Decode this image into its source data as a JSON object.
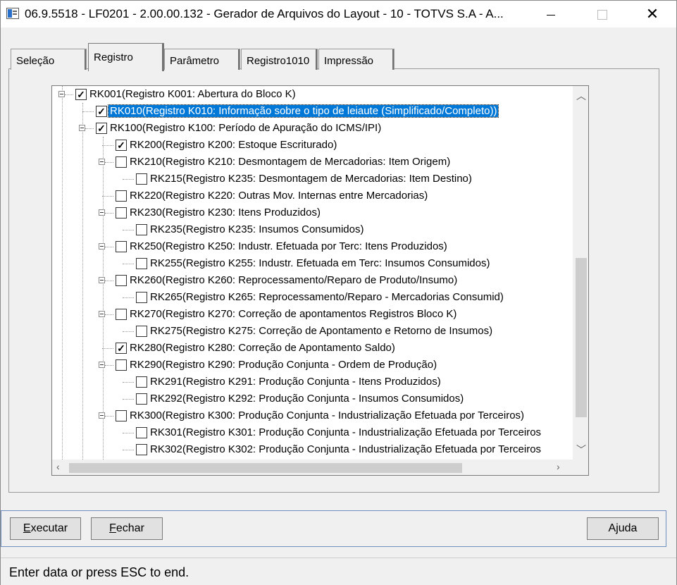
{
  "window": {
    "title": "06.9.5518 - LF0201 - 2.00.00.132 - Gerador de Arquivos do Layout - 10 - TOTVS S.A - A..."
  },
  "tabs": [
    {
      "label": "Seleção"
    },
    {
      "label": "Registro"
    },
    {
      "label": "Parâmetro"
    },
    {
      "label": "Registro1010"
    },
    {
      "label": "Impressão"
    }
  ],
  "tree": {
    "nodes": [
      {
        "label": "RK001(Registro K001: Abertura do Bloco K)",
        "checked": true
      },
      {
        "label": "RK010(Registro K010: Informação sobre o tipo de leiaute (Simplificado/Completo))",
        "checked": true,
        "selected": true
      },
      {
        "label": "RK100(Registro K100: Período de Apuração do ICMS/IPI)",
        "checked": true
      },
      {
        "label": "RK200(Registro K200: Estoque Escriturado)",
        "checked": true
      },
      {
        "label": "RK210(Registro K210: Desmontagem de Mercadorias: Item Origem)",
        "checked": false
      },
      {
        "label": "RK215(Registro K235: Desmontagem de Mercadorias: Item Destino)",
        "checked": false
      },
      {
        "label": "RK220(Registro K220: Outras Mov. Internas entre Mercadorias)",
        "checked": false
      },
      {
        "label": "RK230(Registro K230: Itens Produzidos)",
        "checked": false
      },
      {
        "label": "RK235(Registro K235: Insumos Consumidos)",
        "checked": false
      },
      {
        "label": "RK250(Registro K250: Industr. Efetuada por Terc: Itens Produzidos)",
        "checked": false
      },
      {
        "label": "RK255(Registro K255: Industr. Efetuada em Terc: Insumos Consumidos)",
        "checked": false
      },
      {
        "label": "RK260(Registro K260: Reprocessamento/Reparo de Produto/Insumo)",
        "checked": false
      },
      {
        "label": "RK265(Registro K265: Reprocessamento/Reparo - Mercadorias Consumid)",
        "checked": false
      },
      {
        "label": "RK270(Registro K270: Correção de apontamentos Registros Bloco K)",
        "checked": false
      },
      {
        "label": "RK275(Registro K275: Correção de Apontamento e Retorno de Insumos)",
        "checked": false
      },
      {
        "label": "RK280(Registro K280: Correção de Apontamento Saldo)",
        "checked": true
      },
      {
        "label": "RK290(Registro K290: Produção Conjunta - Ordem de Produção)",
        "checked": false
      },
      {
        "label": "RK291(Registro K291: Produção Conjunta - Itens Produzidos)",
        "checked": false
      },
      {
        "label": "RK292(Registro K292: Produção Conjunta - Insumos Consumidos)",
        "checked": false
      },
      {
        "label": "RK300(Registro K300: Produção Conjunta - Industrialização Efetuada por Terceiros)",
        "checked": false
      },
      {
        "label": "RK301(Registro K301: Produção Conjunta - Industrialização Efetuada por Terceiros",
        "checked": false
      },
      {
        "label": "RK302(Registro K302: Produção Conjunta - Industrialização Efetuada por Terceiros",
        "checked": false
      }
    ]
  },
  "buttons": {
    "executar": {
      "first": "E",
      "rest": "xecutar"
    },
    "fechar": {
      "first": "F",
      "rest": "echar"
    },
    "ajuda": "Ajuda"
  },
  "status": "Enter data or press ESC to end.",
  "colors": {
    "selection": "#0078d7",
    "bottom_border": "#6d8fc0"
  },
  "icons": [
    "app-icon",
    "minimize-icon",
    "maximize-icon",
    "close-icon",
    "scroll-up-icon",
    "scroll-down-icon",
    "scroll-left-icon",
    "scroll-right-icon",
    "expand-collapse-icon",
    "checkbox-icon"
  ]
}
